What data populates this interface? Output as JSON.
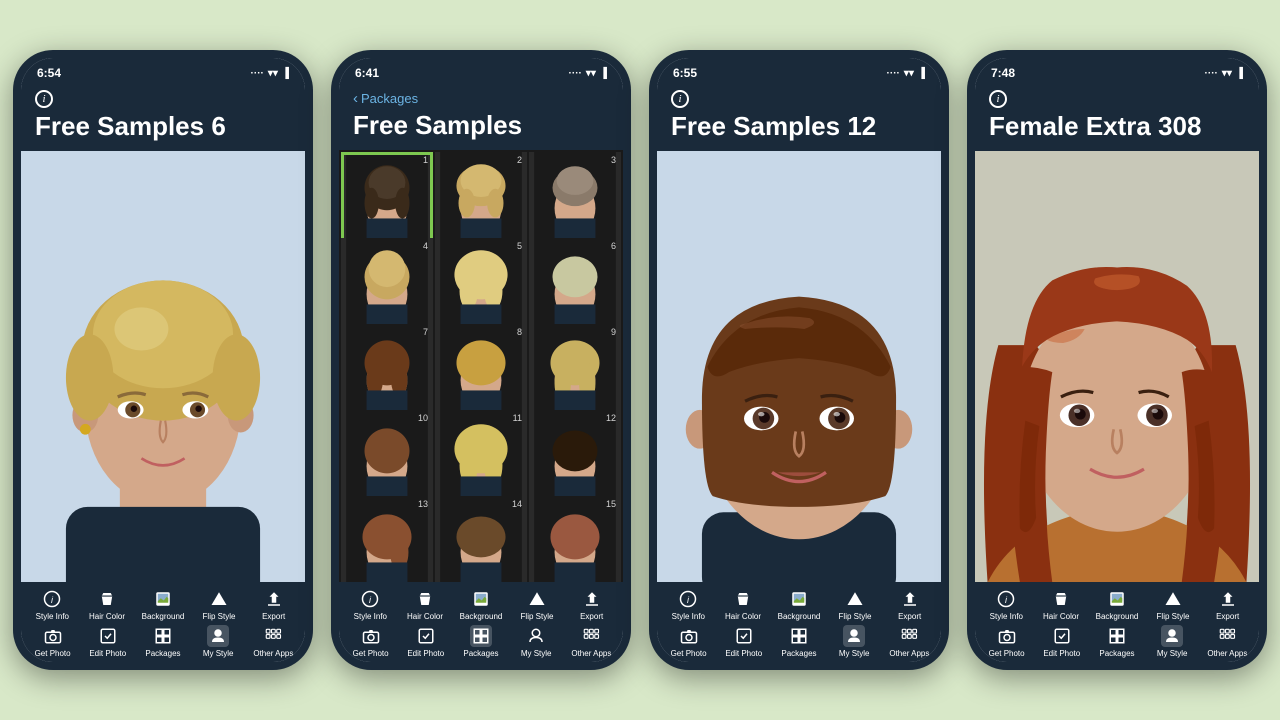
{
  "background": "#d8e8c8",
  "phones": [
    {
      "id": "phone1",
      "status_time": "6:54",
      "title": "Free Samples 6",
      "view": "portrait",
      "has_back": false,
      "hair_color": "blonde",
      "hair_style": "short_pixie"
    },
    {
      "id": "phone2",
      "status_time": "6:41",
      "title": "Free Samples",
      "view": "grid",
      "has_back": true,
      "back_label": "Packages",
      "grid_count": 15,
      "selected_cell": 1
    },
    {
      "id": "phone3",
      "status_time": "6:55",
      "title": "Free Samples 12",
      "view": "portrait",
      "has_back": false,
      "hair_color": "brown_bob",
      "hair_style": "bob_bangs"
    },
    {
      "id": "phone4",
      "status_time": "7:48",
      "title": "Female Extra 308",
      "view": "portrait",
      "has_back": false,
      "hair_color": "auburn",
      "hair_style": "long_wavy"
    }
  ],
  "toolbar_rows": {
    "row1": [
      {
        "label": "Style Info",
        "icon": "info"
      },
      {
        "label": "Hair Color",
        "icon": "bucket"
      },
      {
        "label": "Background",
        "icon": "photo"
      },
      {
        "label": "Flip Style",
        "icon": "triangle"
      },
      {
        "label": "Export",
        "icon": "share"
      }
    ],
    "row2_phone1": [
      {
        "label": "Get Photo",
        "icon": "camera"
      },
      {
        "label": "Edit Photo",
        "icon": "edit"
      },
      {
        "label": "Packages",
        "icon": "grid"
      },
      {
        "label": "My Style",
        "icon": "person",
        "active": true
      },
      {
        "label": "Other Apps",
        "icon": "apps"
      }
    ],
    "row2_phone2": [
      {
        "label": "Get Photo",
        "icon": "camera"
      },
      {
        "label": "Edit Photo",
        "icon": "edit"
      },
      {
        "label": "Packages",
        "icon": "grid",
        "active": true
      },
      {
        "label": "My Style",
        "icon": "person"
      },
      {
        "label": "Other Apps",
        "icon": "apps"
      }
    ],
    "row2_phone3": [
      {
        "label": "Get Photo",
        "icon": "camera"
      },
      {
        "label": "Edit Photo",
        "icon": "edit"
      },
      {
        "label": "Packages",
        "icon": "grid"
      },
      {
        "label": "My Style",
        "icon": "person",
        "active": true
      },
      {
        "label": "Other Apps",
        "icon": "apps"
      }
    ],
    "row2_phone4": [
      {
        "label": "Get Photo",
        "icon": "camera"
      },
      {
        "label": "Edit Photo",
        "icon": "edit"
      },
      {
        "label": "Packages",
        "icon": "grid"
      },
      {
        "label": "My Style",
        "icon": "person",
        "active": true
      },
      {
        "label": "Other Apps",
        "icon": "apps"
      }
    ]
  }
}
